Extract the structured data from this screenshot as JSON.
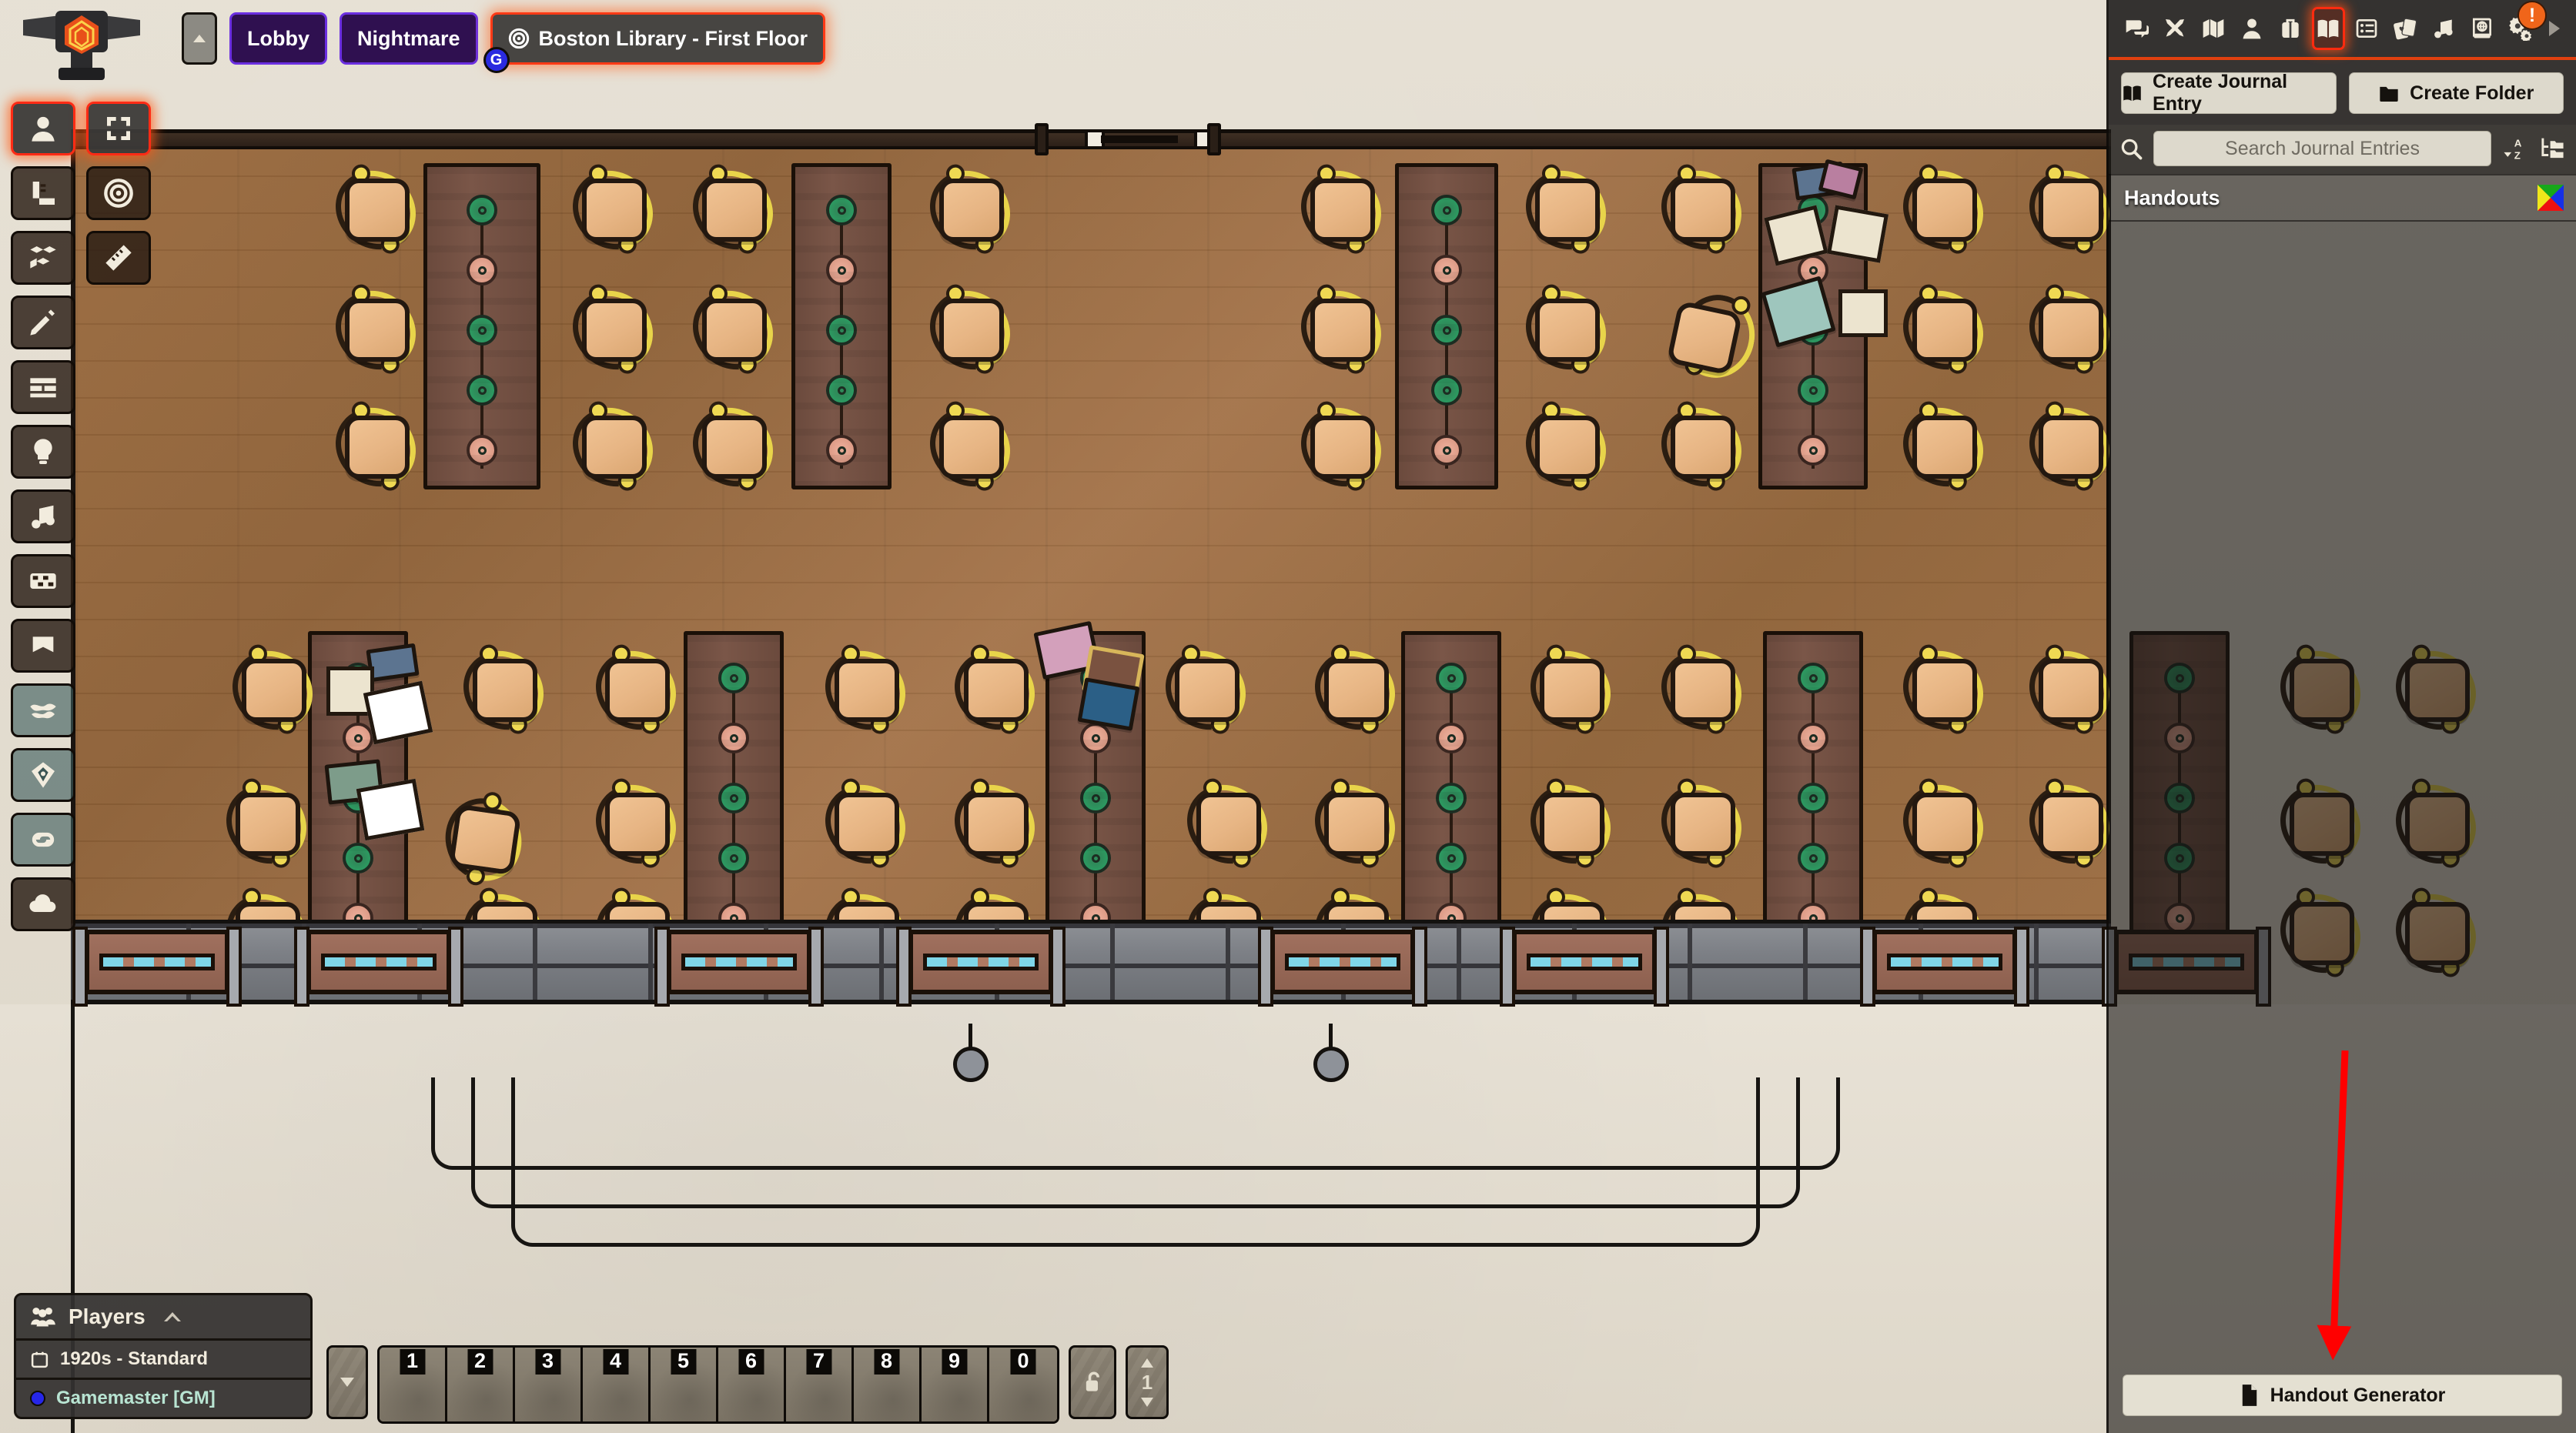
{
  "app": {
    "title": "Boston Library - First Floor",
    "logo_icon": "anvil-d20-logo"
  },
  "scene_nav": {
    "collapse_icon": "chevron-up-icon",
    "tabs": [
      {
        "label": "Lobby",
        "active": false,
        "icon": null,
        "badge": null
      },
      {
        "label": "Nightmare",
        "active": false,
        "icon": null,
        "badge": null
      },
      {
        "label": "Boston Library - First Floor",
        "active": true,
        "icon": "bullseye-icon",
        "badge": "G"
      }
    ]
  },
  "scene_controls": {
    "tools": [
      {
        "name": "token-controls",
        "icon": "user-icon",
        "active": true
      },
      {
        "name": "select-all",
        "icon": "expand-frame-icon",
        "active": true
      },
      {
        "name": "measure-template-controls",
        "icon": "ruler-square-icon",
        "active": false
      },
      {
        "name": "target-controls",
        "icon": "bullseye-icon",
        "active": false
      },
      {
        "name": "tiles-controls",
        "icon": "cubes-icon",
        "active": false
      },
      {
        "name": "ruler-controls",
        "icon": "ruler-icon",
        "active": false
      },
      {
        "name": "drawing-controls",
        "icon": "pencil-icon",
        "active": false
      },
      {
        "name": "walls-controls",
        "icon": "brick-wall-icon",
        "active": false
      },
      {
        "name": "lighting-controls",
        "icon": "lightbulb-icon",
        "active": false
      },
      {
        "name": "sounds-controls",
        "icon": "music-note-icon",
        "active": false
      },
      {
        "name": "regions-controls",
        "icon": "checkerboard-icon",
        "active": false
      },
      {
        "name": "notes-controls",
        "icon": "bookmark-icon",
        "active": false
      },
      {
        "name": "weather-effects",
        "icon": "smoke-icon",
        "active": false
      },
      {
        "name": "dice-tool",
        "icon": "d10-dice-icon",
        "active": false
      },
      {
        "name": "link-tool",
        "icon": "chain-link-icon",
        "active": false
      },
      {
        "name": "cloud-tool",
        "icon": "cloud-icon",
        "active": false
      }
    ]
  },
  "sidebar": {
    "tabs": [
      {
        "name": "chat",
        "icon": "chat-bubbles-icon",
        "active": false,
        "alert": null
      },
      {
        "name": "combat",
        "icon": "crossed-swords-icon",
        "active": false,
        "alert": null
      },
      {
        "name": "scenes",
        "icon": "folded-map-icon",
        "active": false,
        "alert": null
      },
      {
        "name": "actors",
        "icon": "person-icon",
        "active": false,
        "alert": null
      },
      {
        "name": "items",
        "icon": "suitcase-icon",
        "active": false,
        "alert": null
      },
      {
        "name": "journal",
        "icon": "open-book-icon",
        "active": true,
        "alert": null
      },
      {
        "name": "tables",
        "icon": "list-table-icon",
        "active": false,
        "alert": null
      },
      {
        "name": "cards",
        "icon": "playing-cards-icon",
        "active": false,
        "alert": null
      },
      {
        "name": "playlists",
        "icon": "music-note-icon",
        "active": false,
        "alert": null
      },
      {
        "name": "compendium",
        "icon": "globe-book-icon",
        "active": false,
        "alert": null
      },
      {
        "name": "settings",
        "icon": "gears-icon",
        "active": false,
        "alert": "!"
      }
    ],
    "collapse_icon": "caret-right-icon",
    "header": {
      "create_entry_label": "Create Journal Entry",
      "create_entry_icon": "open-book-icon",
      "create_folder_label": "Create Folder",
      "create_folder_icon": "folder-icon"
    },
    "search": {
      "icon": "magnifying-glass-icon",
      "placeholder": "Search Journal Entries",
      "value": "",
      "sort_icon": "sort-alpha-down-icon",
      "tree_icon": "folder-tree-icon"
    },
    "directory": {
      "folders": [
        {
          "name": "Handouts",
          "flag_icon": "color-quad-flag-icon",
          "expanded": true,
          "entries": []
        }
      ]
    },
    "footer": {
      "button_label": "Handout Generator",
      "button_icon": "document-icon"
    },
    "annotation": {
      "type": "red-arrow",
      "points_to": "Handout Generator"
    },
    "accent_color": "#e0400f"
  },
  "players": {
    "title": "Players",
    "group_icon": "people-group-icon",
    "collapse_icon": "chevron-up-icon",
    "world_icon": "calendar-icon",
    "world_name": "1920s - Standard",
    "users": [
      {
        "name": "Gamemaster [GM]",
        "status_color": "#2626e8",
        "text_color": "#b8e4d2"
      }
    ]
  },
  "hotbar": {
    "prev_icon": "caret-down-icon",
    "slots": [
      "1",
      "2",
      "3",
      "4",
      "5",
      "6",
      "7",
      "8",
      "9",
      "0"
    ],
    "lock_icon": "unlocked-padlock-icon",
    "page": "1",
    "page_up_icon": "caret-up-icon",
    "page_down_icon": "caret-down-icon"
  },
  "map": {
    "name": "Boston Library - First Floor",
    "description": "Top-down battlemap: reading room with rows of wooden desks and yellow chairs between brown bookshelves, stone wall with windows along the bottom, lobby floor below."
  }
}
